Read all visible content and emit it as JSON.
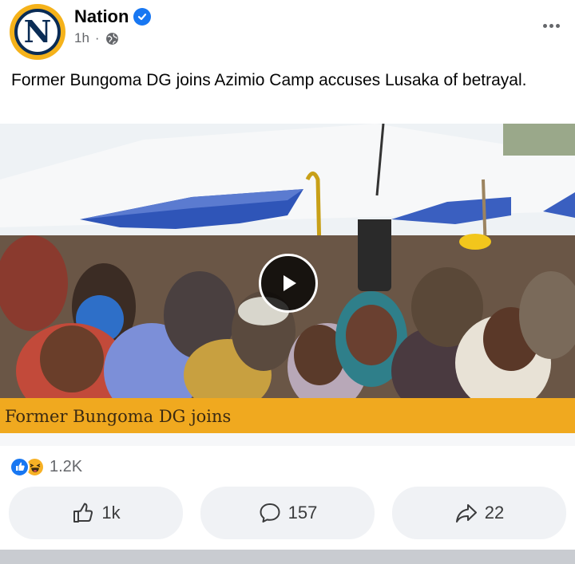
{
  "post": {
    "page_name": "Nation",
    "avatar_letter": "N",
    "time": "1h",
    "separator": "·",
    "privacy_icon": "globe-icon",
    "menu_icon": "more-horizontal-icon",
    "caption": "Former Bungoma DG joins Azimio Camp accuses Lusaka of betrayal."
  },
  "video": {
    "banner_text": "Former Bungoma DG joins",
    "play_icon": "play-icon"
  },
  "reactions": {
    "icons": [
      "like-icon",
      "haha-icon"
    ],
    "count": "1.2K"
  },
  "actions": {
    "like_count": "1k",
    "comment_count": "157",
    "share_count": "22"
  },
  "colors": {
    "brand_blue": "#1877f2",
    "nation_navy": "#0a2c55",
    "nation_gold": "#f5b21a",
    "banner_orange": "#f0a91f",
    "action_bg": "#f0f2f5"
  }
}
